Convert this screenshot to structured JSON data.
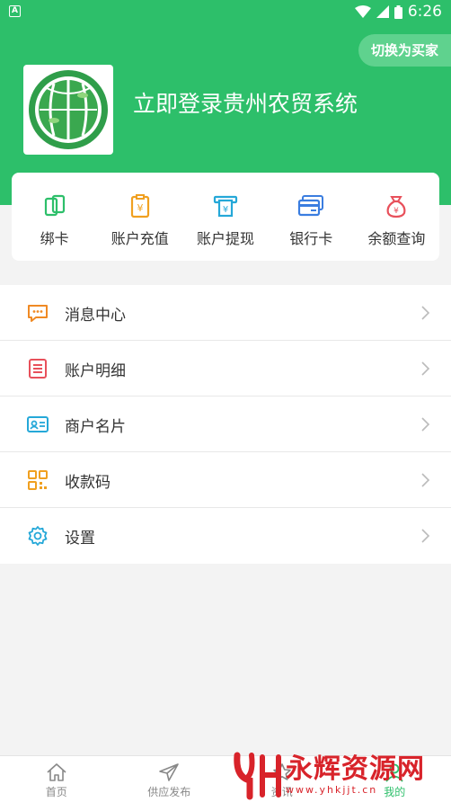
{
  "status_bar": {
    "time": "6:26",
    "notification_letter": "A"
  },
  "header": {
    "switch_button": "切换为买家",
    "login_title": "立即登录贵州农贸系统"
  },
  "quick_actions": [
    {
      "label": "绑卡",
      "icon": "bind-card-icon",
      "color": "#2dbf6a"
    },
    {
      "label": "账户充值",
      "icon": "recharge-icon",
      "color": "#f0a020"
    },
    {
      "label": "账户提现",
      "icon": "withdraw-icon",
      "color": "#25a8d8"
    },
    {
      "label": "银行卡",
      "icon": "bank-card-icon",
      "color": "#3a7de0"
    },
    {
      "label": "余额查询",
      "icon": "money-bag-icon",
      "color": "#e8505b"
    }
  ],
  "menu": [
    {
      "label": "消息中心",
      "icon": "message-icon",
      "color": "#f08a24"
    },
    {
      "label": "账户明细",
      "icon": "list-icon",
      "color": "#e8505b"
    },
    {
      "label": "商户名片",
      "icon": "card-icon",
      "color": "#25a8d8"
    },
    {
      "label": "收款码",
      "icon": "qrcode-icon",
      "color": "#f0a020"
    },
    {
      "label": "设置",
      "icon": "gear-icon",
      "color": "#25a8d8"
    }
  ],
  "tabbar": [
    {
      "label": "首页",
      "icon": "home-icon",
      "active": false
    },
    {
      "label": "供应发布",
      "icon": "send-icon",
      "active": false
    },
    {
      "label": "资讯",
      "icon": "news-icon",
      "active": false
    },
    {
      "label": "我的",
      "icon": "user-icon",
      "active": true
    }
  ],
  "watermark": {
    "text": "永辉资源网",
    "url": "www.yhkjjt.cn"
  },
  "colors": {
    "brand_green": "#2dbf6a",
    "watermark_red": "#d8232a"
  }
}
